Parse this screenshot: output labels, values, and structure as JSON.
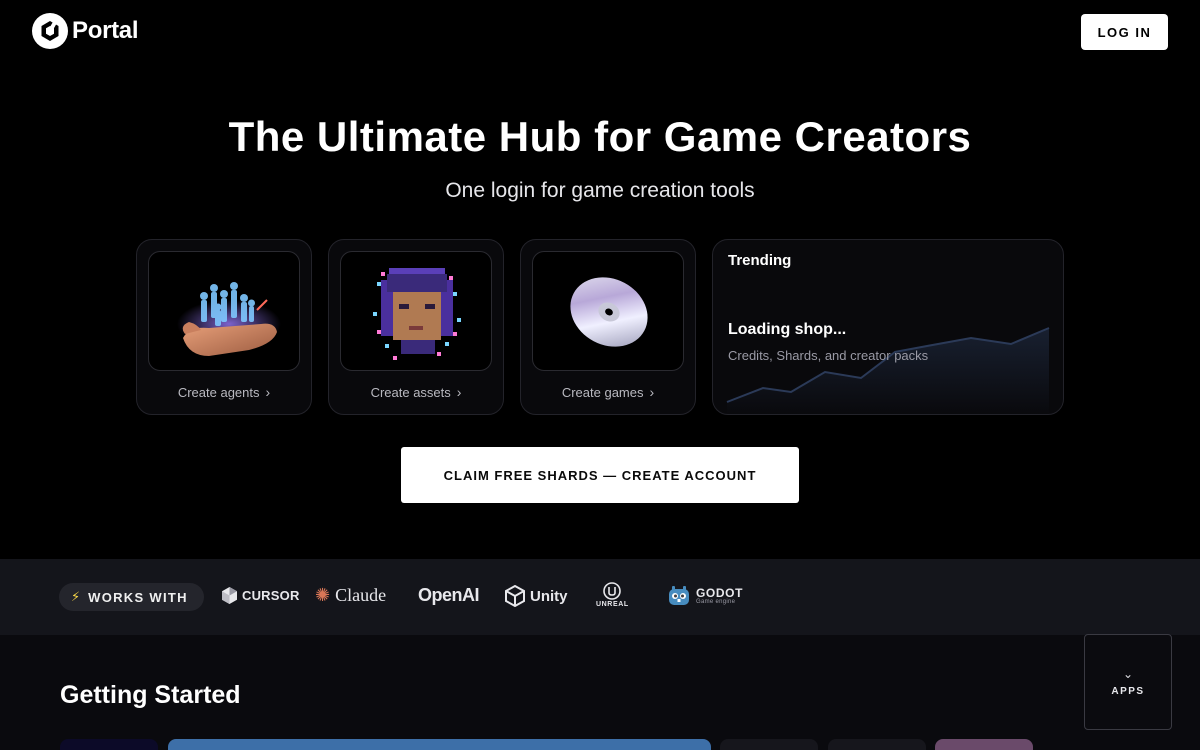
{
  "header": {
    "brand": "Portal",
    "login_label": "LOG IN"
  },
  "hero": {
    "title": "The Ultimate Hub for Game Creators",
    "subtitle": "One login for game creation tools"
  },
  "cards": [
    {
      "label": "Create agents",
      "icon": "agents-hand-icon"
    },
    {
      "label": "Create assets",
      "icon": "pixel-portrait-icon"
    },
    {
      "label": "Create games",
      "icon": "disc-icon"
    }
  ],
  "trending": {
    "title": "Trending",
    "loading": "Loading shop...",
    "description": "Credits, Shards, and creator packs"
  },
  "cta": {
    "label": "CLAIM FREE SHARDS — CREATE ACCOUNT"
  },
  "works_with": {
    "label": "WORKS WITH",
    "partners": {
      "cursor": "CURSOR",
      "claude": "Claude",
      "openai": "OpenAI",
      "unity": "Unity",
      "unreal": "UNREAL",
      "godot": "GODOT",
      "godot_sub": "Game engine"
    }
  },
  "getting_started": {
    "title": "Getting Started"
  },
  "apps": {
    "label": "APPS"
  },
  "colors": {
    "background": "#000000",
    "strip": "#14151b",
    "accent_bolt": "#f5d547",
    "godot_blue": "#478cbf"
  }
}
